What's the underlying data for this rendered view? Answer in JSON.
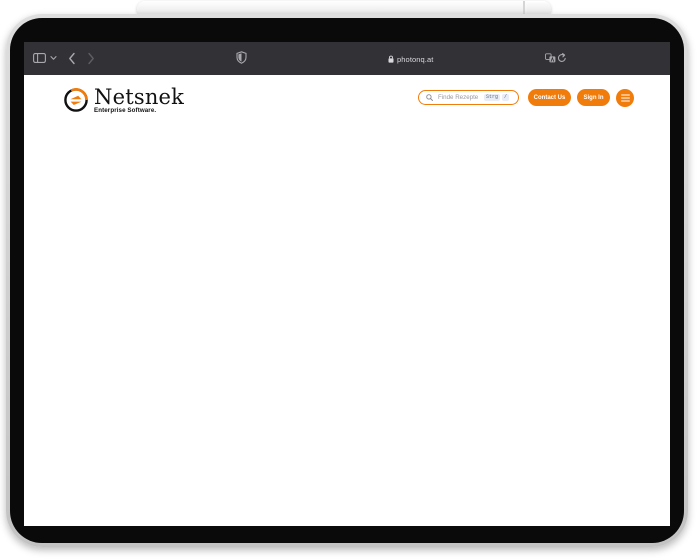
{
  "browser": {
    "url": "photonq.at",
    "icons": {
      "sidebar": "sidebar-icon",
      "sidebar_menu": "chevron-down-icon",
      "back": "chevron-left-icon",
      "forward": "chevron-right-icon",
      "privacy": "shield-icon",
      "secure": "lock-icon",
      "translate": "translate-icon",
      "reload": "reload-icon"
    }
  },
  "site": {
    "brand": {
      "name": "Netsnek",
      "tagline": "Enterprise Software."
    },
    "search": {
      "placeholder": "Finde Rezepte",
      "shortcut_key": "Strg",
      "shortcut_slash": "/"
    },
    "nav": {
      "contact_label": "Contact Us",
      "signin_label": "Sign In",
      "menu_icon": "hamburger-icon"
    },
    "colors": {
      "accent": "#f07c0b",
      "toolbar": "#313136",
      "background": "#ffffff"
    }
  }
}
